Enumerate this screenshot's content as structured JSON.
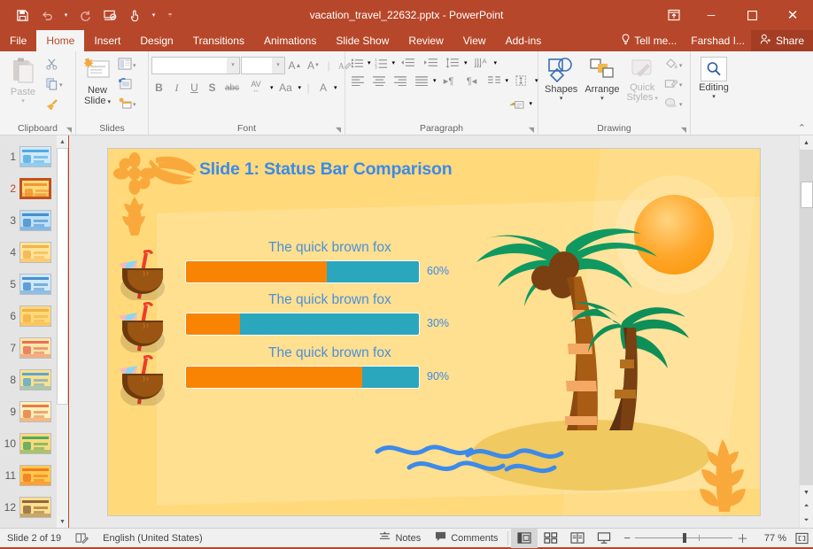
{
  "window": {
    "title": "vacation_travel_22632.pptx - PowerPoint",
    "quick_access": [
      {
        "name": "save",
        "glyph": "὚B"
      },
      {
        "name": "undo",
        "glyph": "↶"
      },
      {
        "name": "redo",
        "glyph": "↻"
      },
      {
        "name": "start-from-beginning",
        "glyph": "▷"
      },
      {
        "name": "touch-mode",
        "glyph": "☝"
      }
    ],
    "controls": {
      "ribbon_display": "⤓",
      "minimize": "─",
      "maximize": "☐",
      "close": "✕"
    }
  },
  "ribbon": {
    "tabs": [
      {
        "label": "File",
        "active": false
      },
      {
        "label": "Home",
        "active": true
      },
      {
        "label": "Insert",
        "active": false
      },
      {
        "label": "Design",
        "active": false
      },
      {
        "label": "Transitions",
        "active": false
      },
      {
        "label": "Animations",
        "active": false
      },
      {
        "label": "Slide Show",
        "active": false
      },
      {
        "label": "Review",
        "active": false
      },
      {
        "label": "View",
        "active": false
      },
      {
        "label": "Add-ins",
        "active": false
      }
    ],
    "tell_me": "Tell me...",
    "user_name": "Farshad I...",
    "share": "Share",
    "groups": [
      {
        "label": "Clipboard"
      },
      {
        "label": "Slides"
      },
      {
        "label": "Font"
      },
      {
        "label": "Paragraph"
      },
      {
        "label": "Drawing"
      }
    ],
    "clipboard": {
      "paste": "Paste"
    },
    "slides": {
      "new_slide": "New\nSlide",
      "new_slide_line1": "New",
      "new_slide_line2": "Slide"
    },
    "font": {
      "name_value": "",
      "size_value": ""
    },
    "drawing": {
      "shapes": "Shapes",
      "arrange": "Arrange",
      "quick_styles_l1": "Quick",
      "quick_styles_l2": "Styles"
    },
    "editing": {
      "label": "Editing"
    },
    "collapse_icon": "⌃"
  },
  "thumbnails": {
    "items": [
      {
        "number": "1",
        "selected": false
      },
      {
        "number": "2",
        "selected": true
      },
      {
        "number": "3",
        "selected": false
      },
      {
        "number": "4",
        "selected": false
      },
      {
        "number": "5",
        "selected": false
      },
      {
        "number": "6",
        "selected": false
      },
      {
        "number": "7",
        "selected": false
      },
      {
        "number": "8",
        "selected": false
      },
      {
        "number": "9",
        "selected": false
      },
      {
        "number": "10",
        "selected": false
      },
      {
        "number": "11",
        "selected": false
      },
      {
        "number": "12",
        "selected": false
      }
    ]
  },
  "slide": {
    "title": "Slide 1: Status Bar Comparison",
    "title_color": "#3d8ae8",
    "background_color": "#ffd97a",
    "bars": [
      {
        "label": "The quick brown fox",
        "percent_label": "60%",
        "percent_value": 60,
        "fill_ratio": 0.605
      },
      {
        "label": "The quick brown fox",
        "percent_label": "30%",
        "percent_value": 30,
        "fill_ratio": 0.232
      },
      {
        "label": "The quick brown fox",
        "percent_label": "90%",
        "percent_value": 90,
        "fill_ratio": 0.755
      }
    ],
    "bar_fill_color": "#f98404",
    "bar_track_color": "#2aa7bd",
    "label_color": "#4a90d9"
  },
  "status_bar": {
    "slide_counter": "Slide 2 of 19",
    "language": "English (United States)",
    "notes": "Notes",
    "comments": "Comments",
    "zoom_level": "77 %",
    "views": [
      {
        "name": "normal-view",
        "glyph": "▤",
        "active": true
      },
      {
        "name": "slide-sorter-view",
        "glyph": "∷",
        "active": false
      },
      {
        "name": "reading-view",
        "glyph": "▥",
        "active": false
      },
      {
        "name": "slide-show-view",
        "glyph": "⬒",
        "active": false
      }
    ],
    "zoom_out": "−",
    "zoom_in": "＋",
    "fit_slide": "⛶"
  }
}
